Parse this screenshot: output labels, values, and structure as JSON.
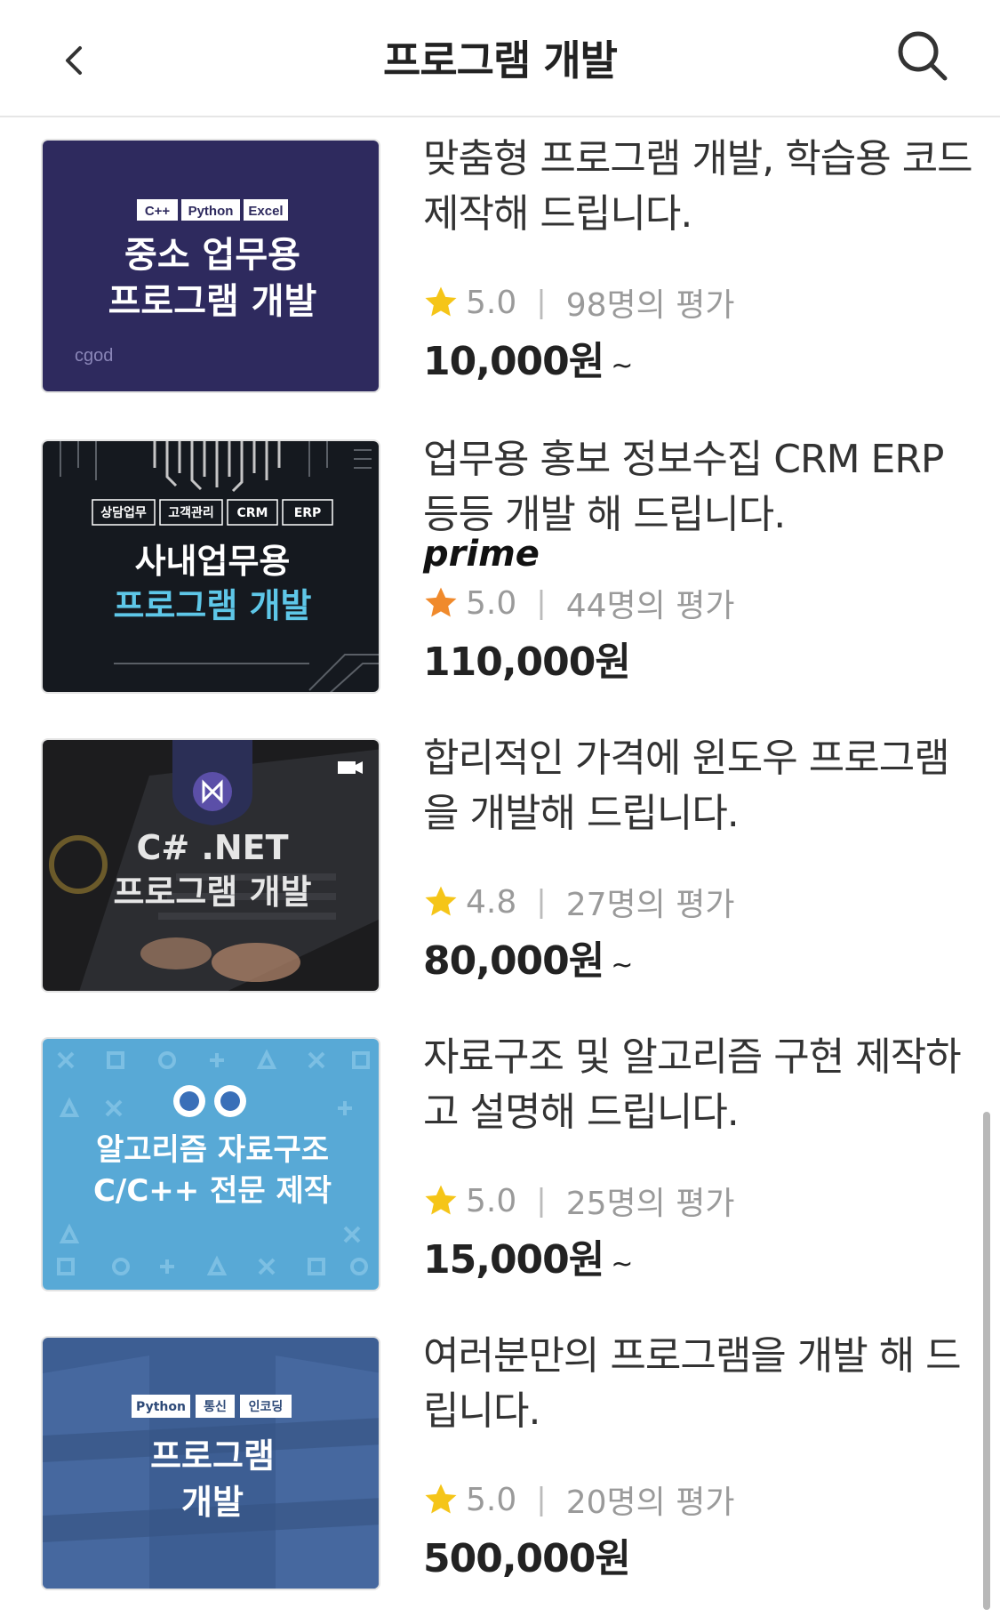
{
  "header": {
    "title": "프로그램 개발"
  },
  "colors": {
    "star_yellow": "#f5c518",
    "star_orange": "#f08a2c",
    "price": "#222222",
    "meta": "#9a9a9a"
  },
  "items": [
    {
      "title": "맞춤형 프로그램 개발, 학습용 코드 제작해 드립니다.",
      "prime": "",
      "rating": "5.0",
      "reviews": "98명의 평가",
      "price": "10,000원",
      "tilde": "~",
      "star_color": "#f5c518",
      "thumb": {
        "tags": [
          "C++",
          "Python",
          "Excel"
        ],
        "line1": "중소 업무용",
        "line2": "프로그램 개발",
        "brand": "cgod"
      }
    },
    {
      "title": "업무용 홍보 정보수집 CRM ERP 등등 개발 해 드립니다.",
      "prime": "prime",
      "rating": "5.0",
      "reviews": "44명의 평가",
      "price": "110,000원",
      "tilde": "",
      "star_color": "#f08a2c",
      "thumb": {
        "tags": [
          "상담업무",
          "고객관리",
          "CRM",
          "ERP"
        ],
        "line1": "사내업무용",
        "line2": "프로그램 개발"
      }
    },
    {
      "title": "합리적인 가격에 윈도우 프로그램을 개발해 드립니다.",
      "prime": "",
      "rating": "4.8",
      "reviews": "27명의 평가",
      "price": "80,000원",
      "tilde": "~",
      "star_color": "#f5c518",
      "thumb": {
        "line1": "C# .NET",
        "line2": "프로그램 개발"
      }
    },
    {
      "title": "자료구조 및 알고리즘 구현 제작하고 설명해 드립니다.",
      "prime": "",
      "rating": "5.0",
      "reviews": "25명의 평가",
      "price": "15,000원",
      "tilde": "~",
      "star_color": "#f5c518",
      "thumb": {
        "line1": "알고리즘 자료구조",
        "line2": "C/C++ 전문 제작"
      }
    },
    {
      "title": "여러분만의 프로그램을 개발 해 드립니다.",
      "prime": "",
      "rating": "5.0",
      "reviews": "20명의 평가",
      "price": "500,000원",
      "tilde": "",
      "star_color": "#f5c518",
      "thumb": {
        "tags": [
          "Python",
          "통신",
          "인코딩"
        ],
        "line1": "프로그램",
        "line2": "개발"
      }
    }
  ]
}
